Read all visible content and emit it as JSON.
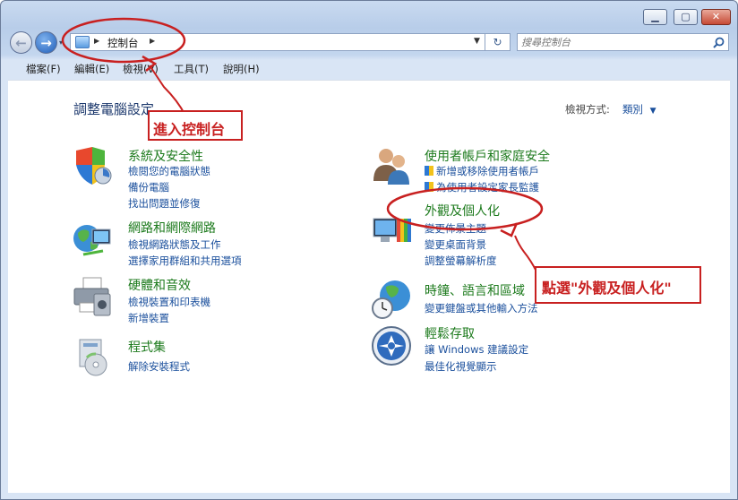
{
  "window": {
    "min_label": "▁",
    "max_label": "▢",
    "close_label": "✕"
  },
  "address_bar": {
    "path": "控制台",
    "refresh": "↻"
  },
  "search": {
    "placeholder": "搜尋控制台"
  },
  "menu": [
    "檔案(F)",
    "編輯(E)",
    "檢視(V)",
    "工具(T)",
    "說明(H)"
  ],
  "page": {
    "title": "調整電腦設定",
    "view_by_label": "檢視方式:",
    "view_by_value": "類別"
  },
  "categories": {
    "system": {
      "title": "系統及安全性",
      "links": [
        "檢閱您的電腦狀態",
        "備份電腦",
        "找出問題並修復"
      ]
    },
    "network": {
      "title": "網路和網際網路",
      "links": [
        "檢視網路狀態及工作",
        "選擇家用群組和共用選項"
      ]
    },
    "hardware": {
      "title": "硬體和音效",
      "links": [
        "檢視裝置和印表機",
        "新增裝置"
      ]
    },
    "programs": {
      "title": "程式集",
      "links": [
        "解除安裝程式"
      ]
    },
    "users": {
      "title": "使用者帳戶和家庭安全",
      "links": [
        "新增或移除使用者帳戶",
        "為使用者設定家長監護"
      ]
    },
    "appearance": {
      "title": "外觀及個人化",
      "links": [
        "變更佈景主題",
        "變更桌面背景",
        "調整螢幕解析度"
      ]
    },
    "clock": {
      "title": "時鐘、語言和區域",
      "links": [
        "變更鍵盤或其他輸入方法"
      ]
    },
    "ease": {
      "title": "輕鬆存取",
      "links": [
        "讓 Windows 建議設定",
        "最佳化視覺顯示"
      ]
    }
  },
  "annotations": {
    "enter_control_panel": "進入控制台",
    "click_appearance": "點選\"外觀及個人化\""
  },
  "colors": {
    "annotation": "#c82020",
    "link": "#1a4f9c",
    "category_title": "#1c7a1c"
  },
  "icons": [
    "back-arrow-icon",
    "forward-arrow-icon",
    "control-panel-icon",
    "refresh-icon",
    "search-icon",
    "shield-icon",
    "network-globe-icon",
    "printer-icon",
    "programs-icon",
    "users-icon",
    "monitor-colors-icon",
    "globe-clock-icon",
    "ease-of-access-icon"
  ]
}
